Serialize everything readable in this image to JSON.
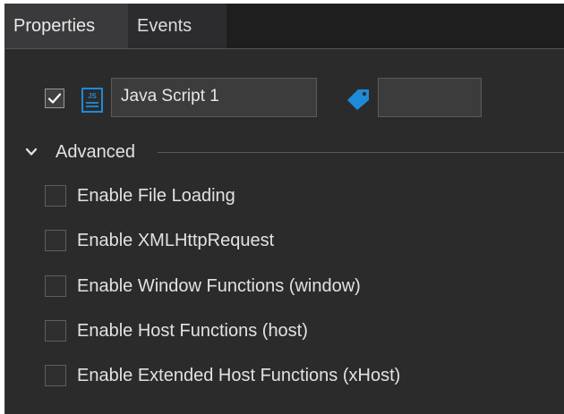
{
  "tabs": [
    {
      "label": "Properties",
      "active": true
    },
    {
      "label": "Events",
      "active": false
    }
  ],
  "script_row": {
    "enabled": true,
    "icon": "js-file-icon",
    "name_value": "Java Script 1",
    "tag_icon": "tag-icon",
    "tag_value": ""
  },
  "advanced": {
    "title": "Advanced",
    "expanded": true,
    "options": [
      {
        "label": "Enable File Loading",
        "checked": false
      },
      {
        "label": "Enable XMLHttpRequest",
        "checked": false
      },
      {
        "label": "Enable Window Functions (window)",
        "checked": false
      },
      {
        "label": "Enable Host Functions (host)",
        "checked": false
      },
      {
        "label": "Enable Extended Host Functions (xHost)",
        "checked": false
      }
    ]
  },
  "colors": {
    "accent": "#1e8bd8",
    "background": "#2b2b2b"
  }
}
